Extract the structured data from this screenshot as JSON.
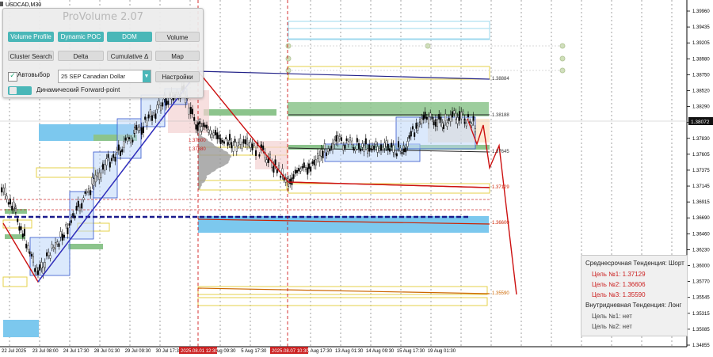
{
  "symbol_label": "USDCAD,M30",
  "colors": {
    "up_candle": "#ffffff",
    "candle": "#000000",
    "trend": "#cc0000",
    "level": "#d4c94a",
    "cluster_blue": "#58b8e8",
    "cluster_green": "#7fb87f",
    "info_red": "#cc2222"
  },
  "panel": {
    "title": "ProVolume 2.07",
    "buttons": [
      {
        "label": "Volume Profile",
        "style": "teal"
      },
      {
        "label": "Dynamic POC",
        "style": "teal"
      },
      {
        "label": "DOM",
        "style": "teal"
      },
      {
        "label": "Volume",
        "style": "gray"
      },
      {
        "label": "Cluster Search",
        "style": "gray"
      },
      {
        "label": "Delta",
        "style": "gray"
      },
      {
        "label": "Cumulative Δ",
        "style": "gray"
      },
      {
        "label": "Map",
        "style": "gray"
      }
    ],
    "auto_select_label": "Автовыбор",
    "instrument_value": "25 SEP Canadian Dollar",
    "settings_label": "Настройки",
    "forward_point_label": "Динамический Forward-point"
  },
  "price_axis": {
    "ticks": [
      "1.39960",
      "1.39435",
      "1.39205",
      "1.38980",
      "1.38750",
      "1.38520",
      "1.38290",
      "1.38060",
      "1.37830",
      "1.37605",
      "1.37375",
      "1.37145",
      "1.36915",
      "1.36690",
      "1.36460",
      "1.36230",
      "1.36000",
      "1.35770",
      "1.35545",
      "1.35315",
      "1.35085",
      "1.34855"
    ],
    "current_price": "1.38072"
  },
  "time_axis": {
    "labels": [
      "22 Jul 2025",
      "23 Jul 08:00",
      "24 Jul 17:30",
      "28 Jul 01:30",
      "29 Jul 09:30",
      "30 Jul 17:30",
      "4 Aug 09:30",
      "5 Aug 17:30",
      "8 Aug 09:30",
      "11 Aug 17:30",
      "13 Aug 01:30",
      "14 Aug 09:30",
      "15 Aug 17:30",
      "19 Aug 01:30"
    ],
    "highlighted": [
      "2025.08.01 12:30",
      "2025.08.07 10:30"
    ]
  },
  "levels": [
    {
      "label": "1.38884"
    },
    {
      "label": "1.38188"
    },
    {
      "label": "1.37800"
    },
    {
      "label": "1.37680"
    },
    {
      "label": "1.37645"
    },
    {
      "label": "1.37129"
    },
    {
      "label": "1.36600"
    },
    {
      "label": "1.35590"
    }
  ],
  "info": {
    "mid_trend_label": "Среднесрочная Тенденция:",
    "mid_trend_value": "Шорт",
    "mid_targets": [
      {
        "label": "Цель №1:",
        "value": "1.37129"
      },
      {
        "label": "Цель №2:",
        "value": "1.36606"
      },
      {
        "label": "Цель №3:",
        "value": "1.35590"
      }
    ],
    "intraday_trend_label": "Внутридневная Тенденция:",
    "intraday_trend_value": "Лонг",
    "intraday_targets": [
      {
        "label": "Цель №1:",
        "value": "нет"
      },
      {
        "label": "Цель №2:",
        "value": "нет"
      }
    ]
  }
}
